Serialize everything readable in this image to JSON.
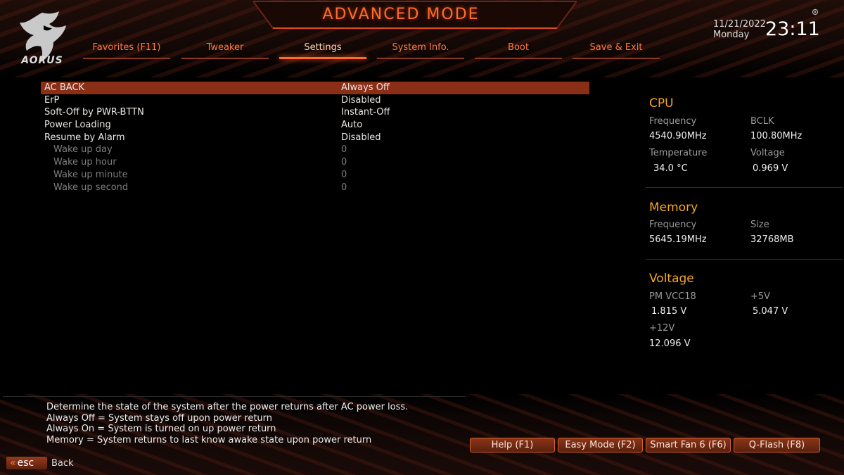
{
  "header": {
    "brand": "AORUS",
    "title": "ADVANCED MODE",
    "date": "11/21/2022",
    "day": "Monday",
    "time": "23:11"
  },
  "tabs": [
    {
      "label": "Favorites (F11)",
      "active": false
    },
    {
      "label": "Tweaker",
      "active": false
    },
    {
      "label": "Settings",
      "active": true
    },
    {
      "label": "System Info.",
      "active": false
    },
    {
      "label": "Boot",
      "active": false
    },
    {
      "label": "Save & Exit",
      "active": false
    }
  ],
  "settings": [
    {
      "label": "AC BACK",
      "value": "Always Off"
    },
    {
      "label": "ErP",
      "value": "Disabled"
    },
    {
      "label": "Soft-Off by PWR-BTTN",
      "value": "Instant-Off"
    },
    {
      "label": "Power Loading",
      "value": "Auto"
    },
    {
      "label": "Resume by Alarm",
      "value": "Disabled"
    },
    {
      "label": "Wake up day",
      "value": "0"
    },
    {
      "label": "Wake up hour",
      "value": "0"
    },
    {
      "label": "Wake up minute",
      "value": "0"
    },
    {
      "label": "Wake up second",
      "value": "0"
    }
  ],
  "cpu": {
    "title": "CPU",
    "frequency_label": "Frequency",
    "frequency": "4540.90MHz",
    "bclk_label": "BCLK",
    "bclk": "100.80MHz",
    "temperature_label": "Temperature",
    "temperature": "34.0 °C",
    "voltage_label": "Voltage",
    "voltage": "0.969 V"
  },
  "memory": {
    "title": "Memory",
    "frequency_label": "Frequency",
    "frequency": "5645.19MHz",
    "size_label": "Size",
    "size": "32768MB"
  },
  "voltage": {
    "title": "Voltage",
    "pmvcc18_label": "PM VCC18",
    "pmvcc18": "1.815 V",
    "v5_label": "+5V",
    "v5": "5.047 V",
    "v12_label": "+12V",
    "v12": "12.096 V"
  },
  "description": [
    "Determine the state of  the system after the power returns after AC power loss.",
    "Always Off = System stays off upon power return",
    "Always On = System is turned on up power return",
    "Memory = System returns to last know awake state upon power return"
  ],
  "footer": {
    "help": "Help (F1)",
    "easy_mode": "Easy Mode (F2)",
    "smart_fan": "Smart Fan 6 (F6)",
    "qflash": "Q-Flash (F8)",
    "esc": "esc",
    "back": "Back"
  },
  "colors": {
    "accent": "#ff6a2d",
    "selection": "#8a2e16",
    "section_title": "#f5a623"
  }
}
